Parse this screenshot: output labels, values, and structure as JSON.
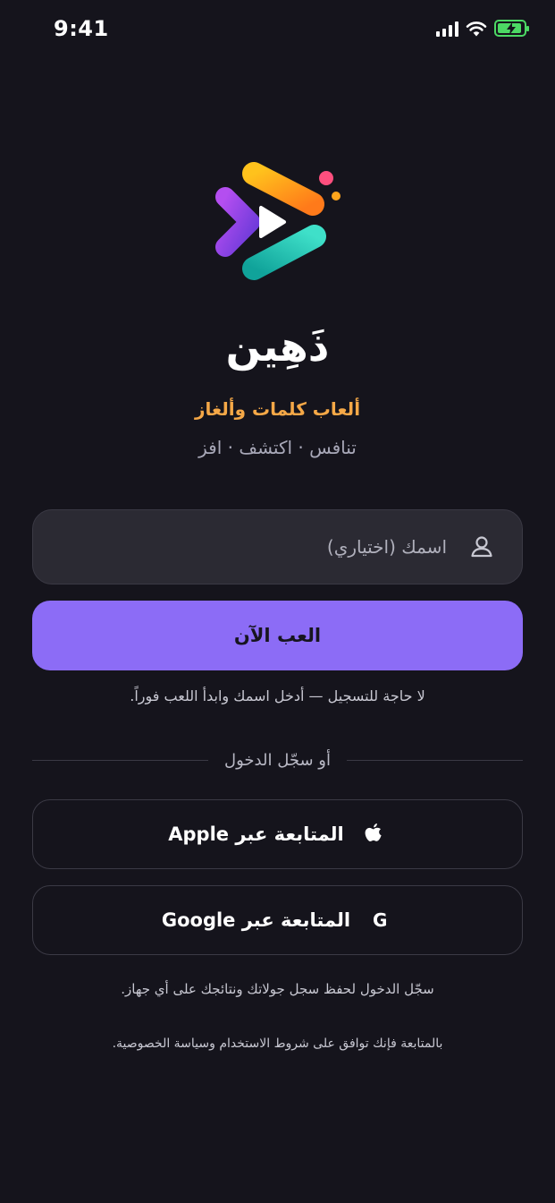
{
  "status_bar": {
    "time": "9:41"
  },
  "brand": {
    "title": "ذَهِين",
    "tagline": "ألعاب كلمات وألغاز",
    "subtitle": "تنافس · اكتشف · افز",
    "logo_icon": "play-chevrons-logo"
  },
  "name_input": {
    "placeholder": "اسمك (اختياري)",
    "value": "",
    "icon": "user-icon"
  },
  "play_button": {
    "label": "العب الآن"
  },
  "no_signup_note": "لا حاجة للتسجيل — أدخل اسمك وابدأ اللعب فوراً.",
  "divider": {
    "label": "أو سجّل الدخول"
  },
  "apple_button": {
    "label": "المتابعة عبر Apple",
    "icon": "apple-icon"
  },
  "google_button": {
    "label": "المتابعة عبر Google",
    "icon": "google-icon",
    "glyph": "G"
  },
  "save_note": "سجّل الدخول لحفظ سجل جولاتك ونتائجك على أي جهاز.",
  "terms_note": "بالمتابعة فإنك توافق على شروط الاستخدام وسياسة الخصوصية.",
  "colors": {
    "background": "#15141c",
    "accent": "#8c6cf6",
    "tagline": "#f5a847",
    "battery": "#4cd964"
  }
}
